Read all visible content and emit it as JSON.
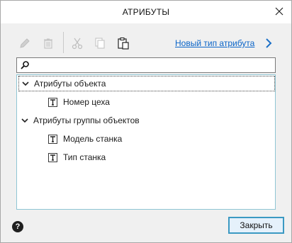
{
  "window": {
    "title": "АТРИБУТЫ"
  },
  "toolbar": {
    "new_attribute_link": "Новый тип атрибута",
    "buttons": [
      "edit-icon",
      "delete-icon",
      "cut-icon",
      "copy-icon",
      "paste-icon"
    ]
  },
  "search": {
    "value": "",
    "placeholder": ""
  },
  "tree": {
    "groups": [
      {
        "label": "Атрибуты объекта",
        "expanded": true,
        "selected": true,
        "items": [
          {
            "label": "Номер цеха"
          }
        ]
      },
      {
        "label": "Атрибуты группы объектов",
        "expanded": true,
        "selected": false,
        "items": [
          {
            "label": "Модель станка"
          },
          {
            "label": "Тип станка"
          }
        ]
      }
    ]
  },
  "footer": {
    "close_label": "Закрыть",
    "help_icon": "help-icon"
  },
  "colors": {
    "link": "#0a64c8",
    "accent_border": "#3b99c2",
    "tree_border": "#8fc6d4"
  }
}
